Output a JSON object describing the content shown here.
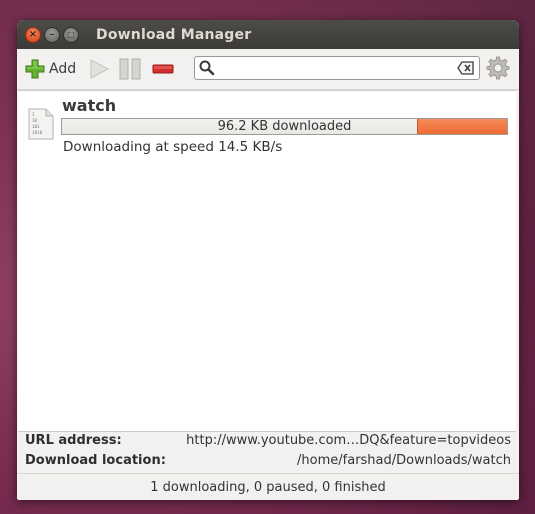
{
  "window": {
    "title": "Download Manager"
  },
  "toolbar": {
    "add_label": "Add",
    "search_placeholder": "",
    "search_value": ""
  },
  "downloads": [
    {
      "name": "watch",
      "progress_text": "96.2 KB downloaded",
      "progress_fraction": 0.2,
      "status": "Downloading at speed 14.5 KB/s",
      "file_icon_text": [
        "1",
        "10",
        "101",
        "1010"
      ]
    }
  ],
  "details": {
    "url_label": "URL address:",
    "url_value": "http://www.youtube.com…DQ&feature=topvideos",
    "location_label": "Download location:",
    "location_value": "/home/farshad/Downloads/watch"
  },
  "statusbar": {
    "text": "1 downloading, 0 paused, 0 finished"
  },
  "colors": {
    "progress_fill": "#ef6b32",
    "titlebar": "#3c3b37",
    "close_button": "#e55b2a",
    "remove_button": "#d42c2c",
    "add_button": "#5fb32a"
  }
}
